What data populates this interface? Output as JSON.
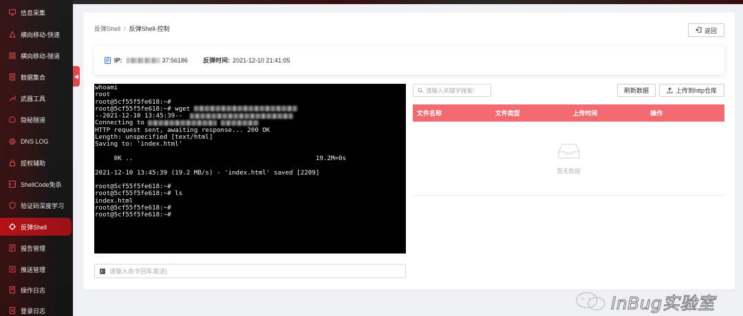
{
  "sidebar": {
    "items": [
      {
        "label": "信息采集",
        "icon": "monitor-icon"
      },
      {
        "label": "横向移动-快速",
        "icon": "network-icon"
      },
      {
        "label": "横向移动-隧道",
        "icon": "grid-icon"
      },
      {
        "label": "数据集合",
        "icon": "database-icon"
      },
      {
        "label": "武器工具",
        "icon": "wrench-icon"
      },
      {
        "label": "隐秘隧道",
        "icon": "tunnel-icon"
      },
      {
        "label": "DNS LOG",
        "icon": "globe-icon"
      },
      {
        "label": "提权辅助",
        "icon": "lock-icon"
      },
      {
        "label": "ShellCode免杀",
        "icon": "code-icon"
      },
      {
        "label": "验证码深度学习",
        "icon": "shield-icon"
      },
      {
        "label": "反弹Shell",
        "icon": "target-icon",
        "active": true
      },
      {
        "label": "报告管理",
        "icon": "report-icon"
      },
      {
        "label": "推送管理",
        "icon": "send-icon"
      },
      {
        "label": "操作日志",
        "icon": "log-icon"
      },
      {
        "label": "登录日志",
        "icon": "login-log-icon"
      }
    ]
  },
  "breadcrumb": {
    "parent": "反弹Shell",
    "separator": "/",
    "current": "反弹Shell-控制"
  },
  "back_button": {
    "label": "返回",
    "icon": "return-icon"
  },
  "info": {
    "ip_label": "IP:",
    "ip_port": "37:56186",
    "time_label": "反弹时间:",
    "time_value": "2021-12-10 21:41:05"
  },
  "terminal": {
    "lines": [
      "whoami",
      "root",
      "root@5cf55f5fe618:~#",
      "root@5cf55f5fe618:~# wget ",
      "--2021-12-10 13:45:39--  ",
      "Connecting to ",
      "HTTP request sent, awaiting response... 200 OK",
      "Length: unspecified [text/html]",
      "Saving to: 'index.html'",
      "",
      "     0K ..                                                19.2M=0s",
      "",
      "2021-12-10 13:45:39 (19.2 MB/s) - 'index.html' saved [2209]",
      "",
      "root@5cf55f5fe618:~#",
      "root@5cf55f5fe618:~# ls",
      "index.html",
      "root@5cf55f5fe618:~#",
      "root@5cf55f5fe618:~#"
    ]
  },
  "command_input": {
    "placeholder": "请输入命令回车发送)"
  },
  "search": {
    "placeholder": "请输入关键字搜索!"
  },
  "toolbar": {
    "refresh_label": "刷新数据",
    "upload_label": "上传到http仓库"
  },
  "file_table": {
    "columns": [
      "文件名称",
      "文件类型",
      "上传时间",
      "操作"
    ],
    "empty_text": "暂无数据"
  },
  "watermark": {
    "text": "InBug实验室"
  },
  "colors": {
    "accent": "#b31217",
    "table_header": "#f06a70",
    "terminal_bg": "#000000",
    "sidebar_bg": "#1b1b1b"
  }
}
